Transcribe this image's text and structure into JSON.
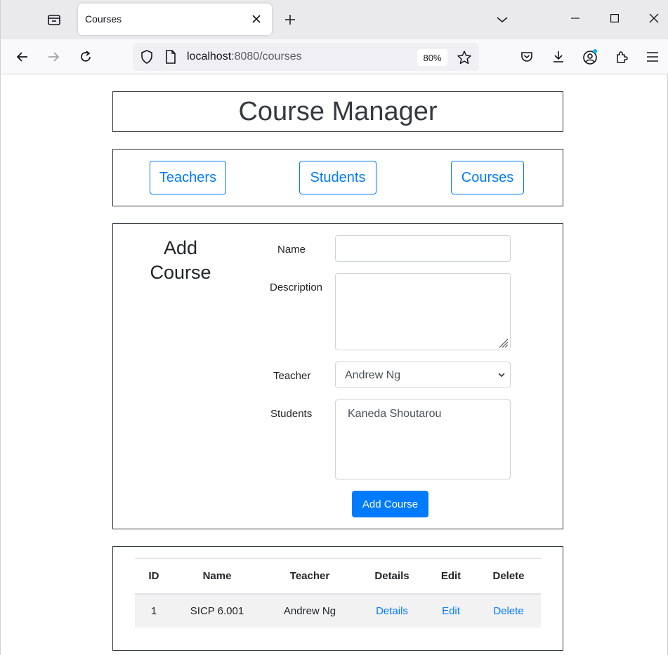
{
  "browser": {
    "tab_title": "Courses",
    "url_host": "localhost",
    "url_rest": ":8080/courses",
    "zoom": "80%"
  },
  "page": {
    "title": "Course Manager",
    "nav": {
      "teachers": "Teachers",
      "students": "Students",
      "courses": "Courses"
    },
    "form": {
      "heading_line1": "Add",
      "heading_line2": "Course",
      "name_label": "Name",
      "name_value": "",
      "description_label": "Description",
      "description_value": "",
      "teacher_label": "Teacher",
      "teacher_selected": "Andrew Ng",
      "students_label": "Students",
      "students_options": [
        "Kaneda Shoutarou"
      ],
      "submit_label": "Add Course"
    },
    "table": {
      "headers": [
        "ID",
        "Name",
        "Teacher",
        "Details",
        "Edit",
        "Delete"
      ],
      "rows": [
        {
          "id": "1",
          "name": "SICP 6.001",
          "teacher": "Andrew Ng",
          "details": "Details",
          "edit": "Edit",
          "delete": "Delete"
        }
      ]
    }
  },
  "colors": {
    "accent": "#007bff",
    "panel_border": "#343a40",
    "row_stripe": "#f2f2f2"
  },
  "icons": [
    "tab-list-icon",
    "close-icon",
    "plus-icon",
    "chevron-down-icon",
    "minimize-icon",
    "maximize-icon",
    "back-icon",
    "forward-icon",
    "reload-icon",
    "shield-icon",
    "page-icon",
    "star-icon",
    "pocket-icon",
    "download-icon",
    "account-icon",
    "extensions-icon",
    "menu-icon"
  ]
}
